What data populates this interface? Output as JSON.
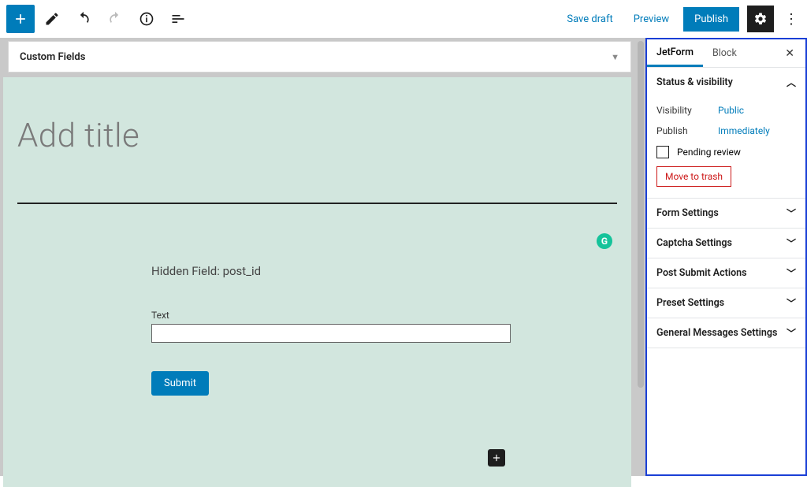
{
  "toolbar": {
    "save_draft": "Save draft",
    "preview": "Preview",
    "publish": "Publish"
  },
  "customFieldsBar": {
    "label": "Custom Fields"
  },
  "editor": {
    "title_placeholder": "Add title",
    "hidden_field_label": "Hidden Field: post_id",
    "text_field_label": "Text",
    "text_field_value": "",
    "submit_label": "Submit"
  },
  "sidebar": {
    "tabs": {
      "jetform": "JetForm",
      "block": "Block"
    },
    "status_panel": {
      "title": "Status & visibility",
      "visibility_label": "Visibility",
      "visibility_value": "Public",
      "publish_label": "Publish",
      "publish_value": "Immediately",
      "pending_review": "Pending review",
      "move_to_trash": "Move to trash"
    },
    "panels": [
      "Form Settings",
      "Captcha Settings",
      "Post Submit Actions",
      "Preset Settings",
      "General Messages Settings"
    ]
  }
}
